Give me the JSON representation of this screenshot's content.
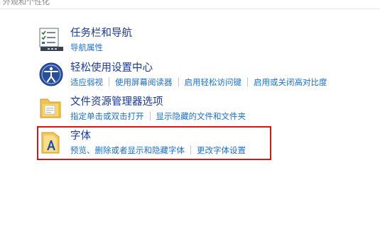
{
  "breadcrumb": "外观和个性化",
  "categories": [
    {
      "title": "任务栏和导航",
      "icon": "taskbar-icon",
      "links": [
        "导航属性"
      ]
    },
    {
      "title": "轻松使用设置中心",
      "icon": "ease-of-access-icon",
      "links": [
        "适应弱视",
        "使用屏幕阅读器",
        "启用轻松访问键",
        "启用或关闭高对比度"
      ]
    },
    {
      "title": "文件资源管理器选项",
      "icon": "folder-options-icon",
      "links": [
        "指定单击或双击打开",
        "显示隐藏的文件和文件夹"
      ]
    },
    {
      "title": "字体",
      "icon": "fonts-icon",
      "links": [
        "预览、删除或者显示和隐藏字体",
        "更改字体设置"
      ]
    }
  ],
  "colors": {
    "title": "#1a3a9a",
    "link": "#1a6fcf",
    "highlight": "#d01818"
  }
}
